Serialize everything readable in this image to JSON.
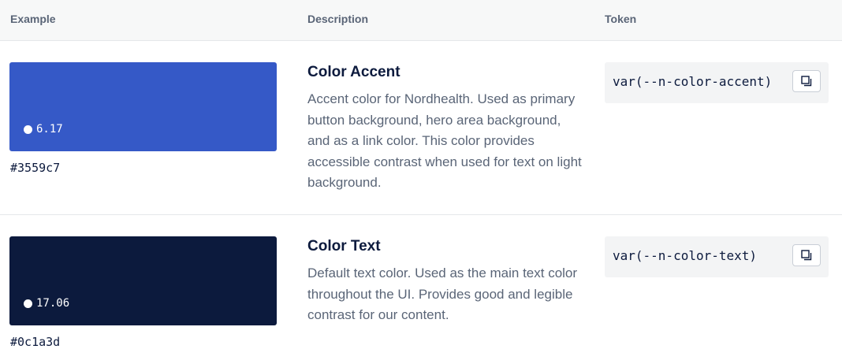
{
  "header": {
    "example": "Example",
    "description": "Description",
    "token": "Token"
  },
  "rows": [
    {
      "swatch_color": "#3559c7",
      "contrast": "6.17",
      "hex": "#3559c7",
      "title": "Color Accent",
      "description": "Accent color for Nordhealth. Used as primary button background, hero area background, and as a link color. This color provides accessible contrast when used for text on light background.",
      "token": "var(--n-color-accent)",
      "copy_icon": "copy-icon"
    },
    {
      "swatch_color": "#0c1a3d",
      "contrast": "17.06",
      "hex": "#0c1a3d",
      "title": "Color Text",
      "description": "Default text color. Used as the main text color throughout the UI. Provides good and legible contrast for our content.",
      "token": "var(--n-color-text)",
      "copy_icon": "copy-icon"
    }
  ]
}
